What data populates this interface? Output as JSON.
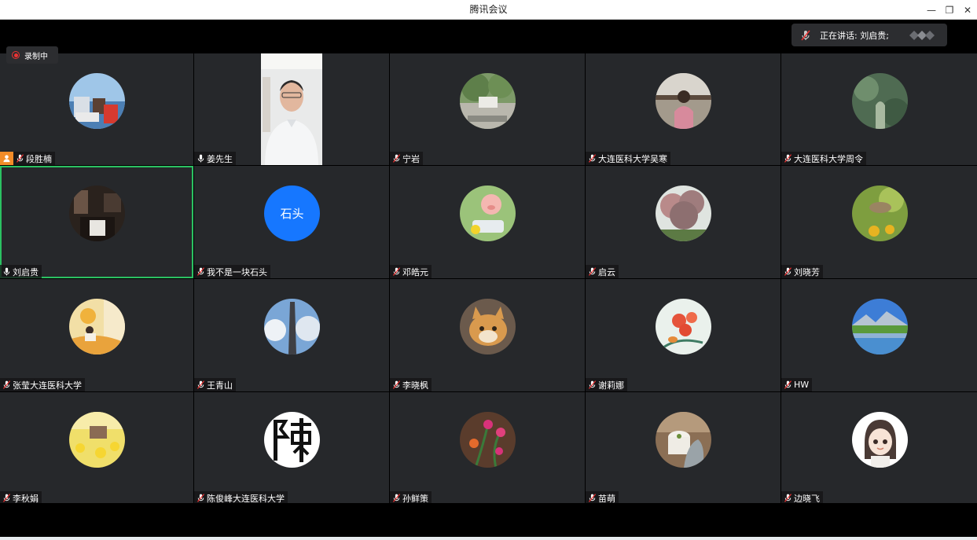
{
  "window": {
    "title": "腾讯会议",
    "controls": {
      "minimize": "—",
      "restore": "❐",
      "close": "✕"
    }
  },
  "recording": {
    "label": "录制中"
  },
  "speaking": {
    "label": "正在讲话: 刘启贵;"
  },
  "colors": {
    "tile_bg": "#26282b",
    "active_border": "#2bc162",
    "host_badge": "#f28c28",
    "avatar_blue": "#1677ff",
    "recording_red": "#e33333"
  },
  "participants": [
    {
      "name": "段胜楠",
      "host": true,
      "mic": "muted",
      "avatar": "photo-harbor-avatar"
    },
    {
      "name": "姜先生",
      "host": false,
      "mic": "on",
      "avatar": "camera-video"
    },
    {
      "name": "宁岩",
      "host": false,
      "mic": "muted",
      "avatar": "photo-park-avatar"
    },
    {
      "name": "大连医科大学吴寒",
      "host": false,
      "mic": "muted",
      "avatar": "photo-girl-avatar"
    },
    {
      "name": "大连医科大学周令",
      "host": false,
      "mic": "muted",
      "avatar": "photo-green-avatar"
    },
    {
      "name": "刘启贵",
      "host": false,
      "mic": "on",
      "active": true,
      "avatar": "photo-room-avatar"
    },
    {
      "name": "我不是一块石头",
      "host": false,
      "mic": "muted",
      "avatar": "text-avatar",
      "avatar_text": "石头"
    },
    {
      "name": "邓皓元",
      "host": false,
      "mic": "muted",
      "avatar": "cartoon-pig-avatar"
    },
    {
      "name": "启云",
      "host": false,
      "mic": "muted",
      "avatar": "photo-tree-avatar"
    },
    {
      "name": "刘晓芳",
      "host": false,
      "mic": "muted",
      "avatar": "photo-bird-avatar"
    },
    {
      "name": "张莹大连医科大学",
      "host": false,
      "mic": "muted",
      "avatar": "illustration-avatar"
    },
    {
      "name": "王青山",
      "host": false,
      "mic": "muted",
      "avatar": "photo-monument-avatar"
    },
    {
      "name": "李晓枫",
      "host": false,
      "mic": "muted",
      "avatar": "photo-cat-avatar"
    },
    {
      "name": "谢莉娜",
      "host": false,
      "mic": "muted",
      "avatar": "painting-flowers-avatar"
    },
    {
      "name": "HW",
      "host": false,
      "mic": "muted",
      "avatar": "photo-lake-avatar"
    },
    {
      "name": "李秋娟",
      "host": false,
      "mic": "muted",
      "avatar": "photo-yellow-field-avatar"
    },
    {
      "name": "陈俊峰大连医科大学",
      "host": false,
      "mic": "muted",
      "avatar": "calligraphy-avatar"
    },
    {
      "name": "孙鲜策",
      "host": false,
      "mic": "muted",
      "avatar": "photo-flowers-avatar"
    },
    {
      "name": "苗萌",
      "host": false,
      "mic": "muted",
      "avatar": "photo-teacup-avatar"
    },
    {
      "name": "边晓飞",
      "host": false,
      "mic": "muted",
      "avatar": "cartoon-girl-avatar"
    }
  ]
}
